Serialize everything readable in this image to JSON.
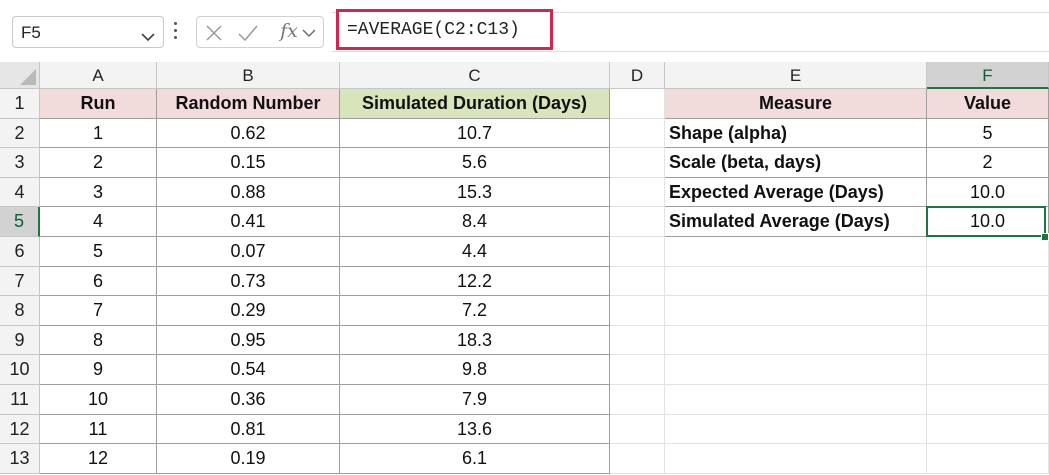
{
  "name_box": {
    "value": "F5"
  },
  "formula_bar": {
    "cancel_icon": "x-icon",
    "enter_icon": "check-icon",
    "function_label": "fx",
    "formula": "=AVERAGE(C2:C13)"
  },
  "columns": [
    "A",
    "B",
    "C",
    "D",
    "E",
    "F"
  ],
  "selected_column": "F",
  "rows": [
    "1",
    "2",
    "3",
    "4",
    "5",
    "6",
    "7",
    "8",
    "9",
    "10",
    "11",
    "12",
    "13"
  ],
  "selected_row": "5",
  "simulation_table": {
    "headers": [
      "Run",
      "Random Number",
      "Simulated Duration (Days)"
    ],
    "data": [
      [
        "1",
        "0.62",
        "10.7"
      ],
      [
        "2",
        "0.15",
        "5.6"
      ],
      [
        "3",
        "0.88",
        "15.3"
      ],
      [
        "4",
        "0.41",
        "8.4"
      ],
      [
        "5",
        "0.07",
        "4.4"
      ],
      [
        "6",
        "0.73",
        "12.2"
      ],
      [
        "7",
        "0.29",
        "7.2"
      ],
      [
        "8",
        "0.95",
        "18.3"
      ],
      [
        "9",
        "0.54",
        "9.8"
      ],
      [
        "10",
        "0.36",
        "7.9"
      ],
      [
        "11",
        "0.81",
        "13.6"
      ],
      [
        "12",
        "0.19",
        "6.1"
      ]
    ]
  },
  "summary_table": {
    "headers": [
      "Measure",
      "Value"
    ],
    "data": [
      [
        "Shape (alpha)",
        "5"
      ],
      [
        "Scale (beta, days)",
        "2"
      ],
      [
        "Expected Average (Days)",
        "10.0"
      ],
      [
        "Simulated Average (Days)",
        "10.0"
      ]
    ]
  },
  "colors": {
    "selection": "#217346",
    "formula_highlight": "#d3264f",
    "header_pink": "#f2dcdb",
    "header_green": "#d8e4bc"
  }
}
